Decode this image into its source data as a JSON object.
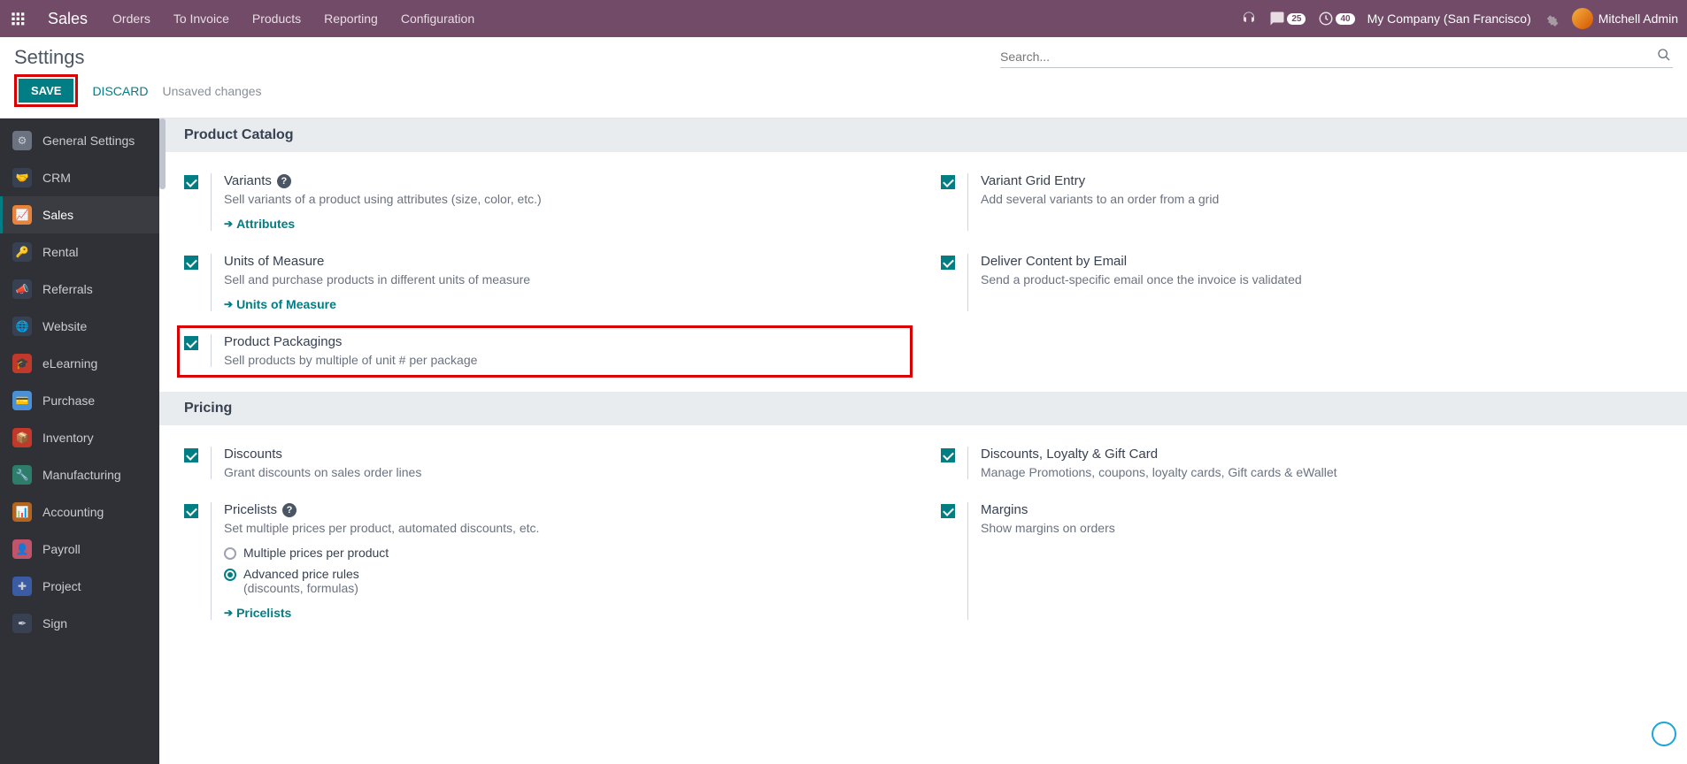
{
  "topnav": {
    "brand": "Sales",
    "menu": [
      "Orders",
      "To Invoice",
      "Products",
      "Reporting",
      "Configuration"
    ],
    "messages_badge": "25",
    "activities_badge": "40",
    "company": "My Company (San Francisco)",
    "user": "Mitchell Admin"
  },
  "subheader": {
    "title": "Settings",
    "search_placeholder": "Search...",
    "save": "SAVE",
    "discard": "DISCARD",
    "unsaved": "Unsaved changes"
  },
  "sidebar": {
    "items": [
      {
        "label": "General Settings"
      },
      {
        "label": "CRM"
      },
      {
        "label": "Sales"
      },
      {
        "label": "Rental"
      },
      {
        "label": "Referrals"
      },
      {
        "label": "Website"
      },
      {
        "label": "eLearning"
      },
      {
        "label": "Purchase"
      },
      {
        "label": "Inventory"
      },
      {
        "label": "Manufacturing"
      },
      {
        "label": "Accounting"
      },
      {
        "label": "Payroll"
      },
      {
        "label": "Project"
      },
      {
        "label": "Sign"
      }
    ]
  },
  "sections": {
    "product_catalog": {
      "heading": "Product Catalog",
      "variants": {
        "title": "Variants",
        "desc": "Sell variants of a product using attributes (size, color, etc.)",
        "link": "Attributes"
      },
      "variant_grid": {
        "title": "Variant Grid Entry",
        "desc": "Add several variants to an order from a grid"
      },
      "uom": {
        "title": "Units of Measure",
        "desc": "Sell and purchase products in different units of measure",
        "link": "Units of Measure"
      },
      "deliver_email": {
        "title": "Deliver Content by Email",
        "desc": "Send a product-specific email once the invoice is validated"
      },
      "packagings": {
        "title": "Product Packagings",
        "desc": "Sell products by multiple of unit # per package"
      }
    },
    "pricing": {
      "heading": "Pricing",
      "discounts": {
        "title": "Discounts",
        "desc": "Grant discounts on sales order lines"
      },
      "loyalty": {
        "title": "Discounts, Loyalty & Gift Card",
        "desc": "Manage Promotions, coupons, loyalty cards, Gift cards & eWallet"
      },
      "pricelists": {
        "title": "Pricelists",
        "desc": "Set multiple prices per product, automated discounts, etc.",
        "opt1": "Multiple prices per product",
        "opt2": "Advanced price rules",
        "opt2_sub": "(discounts, formulas)",
        "link": "Pricelists"
      },
      "margins": {
        "title": "Margins",
        "desc": "Show margins on orders"
      }
    }
  }
}
